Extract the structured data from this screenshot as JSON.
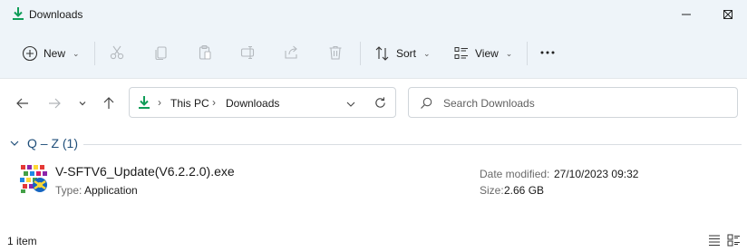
{
  "window": {
    "title": "Downloads",
    "accent": "#0f9d58",
    "controls": {
      "minimize": "minimize-icon",
      "maximize": "maximize-icon",
      "close": "close-icon"
    }
  },
  "toolbar": {
    "new_label": "New",
    "sort_label": "Sort",
    "view_label": "View",
    "icons": [
      "cut-icon",
      "copy-icon",
      "paste-icon",
      "rename-icon",
      "share-icon",
      "delete-icon",
      "more-icon"
    ]
  },
  "navigation": {
    "icons": [
      "back-arrow-icon",
      "forward-arrow-icon",
      "recent-dropdown-icon",
      "up-arrow-icon"
    ]
  },
  "address": {
    "crumbs": [
      "This PC",
      "Downloads"
    ]
  },
  "search": {
    "placeholder": "Search Downloads"
  },
  "group": {
    "label": "Q – Z (1)"
  },
  "files": [
    {
      "name": "V-SFTV6_Update(V6.2.2.0).exe",
      "type_label": "Type:",
      "type_value": "Application",
      "date_label": "Date modified:",
      "date_value": "27/10/2023 09:32",
      "size_label": "Size:",
      "size_value": "2.66 GB"
    }
  ],
  "status": {
    "item_count": "1 item",
    "view_icons": [
      "details-view-icon",
      "tiles-view-icon"
    ]
  }
}
